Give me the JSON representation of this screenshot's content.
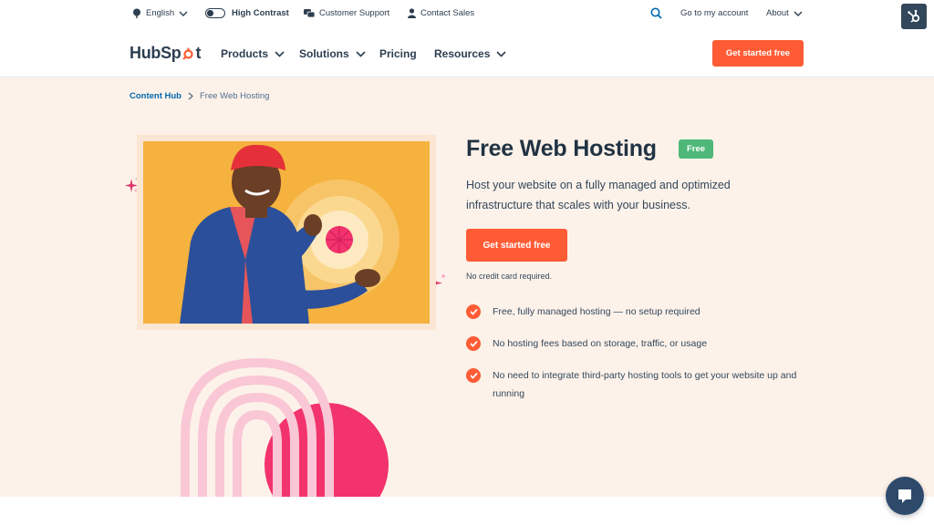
{
  "utility": {
    "language": "English",
    "contrast": "High Contrast",
    "support": "Customer Support",
    "sales": "Contact Sales",
    "account": "Go to my account",
    "about": "About"
  },
  "nav": {
    "logo_prefix": "HubSp",
    "logo_suffix": "t",
    "items": [
      "Products",
      "Solutions",
      "Pricing",
      "Resources"
    ],
    "cta": "Get started free"
  },
  "breadcrumb": {
    "parent": "Content Hub",
    "current": "Free Web Hosting"
  },
  "hero": {
    "title": "Free Web Hosting",
    "badge": "Free",
    "description": "Host your website on a fully managed and optimized infrastructure that scales with your business.",
    "cta": "Get started free",
    "note": "No credit card required.",
    "features": [
      "Free, fully managed hosting — no setup required",
      "No hosting fees based on storage, traffic, or usage",
      "No need to integrate third-party hosting tools to get your website up and running"
    ]
  },
  "colors": {
    "accent": "#ff5c35",
    "badge": "#4db878",
    "hero_bg": "#fdf2e9",
    "link": "#0068b1",
    "photo_bg": "#f5b23e",
    "magenta": "#f2336d"
  }
}
